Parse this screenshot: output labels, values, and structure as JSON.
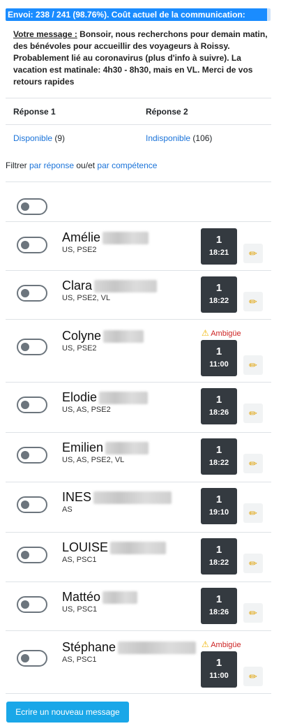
{
  "status": {
    "text": "Envoi: 238 / 241 (98.76%). Coût actuel de la communication:",
    "progress": 0.9876
  },
  "message": {
    "title": "Votre message :",
    "body": " Bonsoir, nous recherchons pour demain matin, des bénévoles pour accueillir des voyageurs à Roissy. Probablement lié au coronavirus (plus d'info à suivre). La vacation est matinale: 4h30 - 8h30, mais en VL. Merci de vos retours rapides"
  },
  "responses": {
    "headers": [
      "Réponse 1",
      "Réponse 2"
    ],
    "values": [
      {
        "label": "Disponible",
        "count": "(9)"
      },
      {
        "label": "Indisponible",
        "count": "(106)"
      }
    ]
  },
  "filter": {
    "prefix": "Filtrer ",
    "link1": "par réponse",
    "middle": " ou/et ",
    "link2": "par compétence"
  },
  "ambiguous_label": "Ambigüe",
  "people": [
    {
      "name": "Amélie",
      "skills": "US, PSE2",
      "count": "1",
      "time": "18:21",
      "ambiguous": false
    },
    {
      "name": "Clara",
      "skills": "US, PSE2, VL",
      "count": "1",
      "time": "18:22",
      "ambiguous": false
    },
    {
      "name": "Colyne",
      "skills": "US, PSE2",
      "count": "1",
      "time": "11:00",
      "ambiguous": true
    },
    {
      "name": "Elodie",
      "skills": "US, AS, PSE2",
      "count": "1",
      "time": "18:26",
      "ambiguous": false
    },
    {
      "name": "Emilien",
      "skills": "US, AS, PSE2, VL",
      "count": "1",
      "time": "18:22",
      "ambiguous": false
    },
    {
      "name": "INES",
      "skills": "AS",
      "count": "1",
      "time": "19:10",
      "ambiguous": false
    },
    {
      "name": "LOUISE",
      "skills": "AS, PSC1",
      "count": "1",
      "time": "18:22",
      "ambiguous": false
    },
    {
      "name": "Mattéo",
      "skills": "US, PSC1",
      "count": "1",
      "time": "18:26",
      "ambiguous": false
    },
    {
      "name": "Stéphane",
      "skills": "AS, PSC1",
      "count": "1",
      "time": "11:00",
      "ambiguous": true
    }
  ],
  "new_message_button": "Ecrire un nouveau message"
}
